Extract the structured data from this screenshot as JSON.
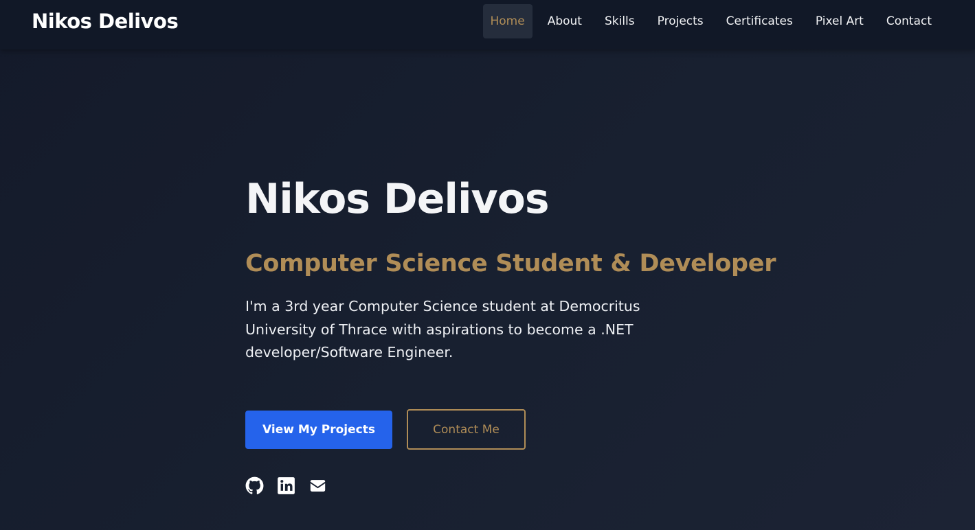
{
  "brand": {
    "name": "Nikos Delivos"
  },
  "nav": {
    "items": [
      {
        "label": "Home",
        "active": true
      },
      {
        "label": "About"
      },
      {
        "label": "Skills"
      },
      {
        "label": "Projects"
      },
      {
        "label": "Certificates"
      },
      {
        "label": "Pixel Art"
      },
      {
        "label": "Contact"
      }
    ]
  },
  "hero": {
    "title": "Nikos Delivos",
    "subtitle": "Computer Science Student & Developer",
    "description": "I'm a 3rd year Computer Science student at Democritus University of Thrace with aspirations to become a .NET developer/Software Engineer.",
    "primary_button": "View My Projects",
    "secondary_button": "Contact Me"
  },
  "socials": [
    {
      "icon": "github-icon"
    },
    {
      "icon": "linkedin-icon"
    },
    {
      "icon": "envelope-icon"
    }
  ],
  "colors": {
    "accent": "#b08d57",
    "primary_button": "#2563eb",
    "navbar_bg": "#111827",
    "page_bg": "#151c2c"
  }
}
